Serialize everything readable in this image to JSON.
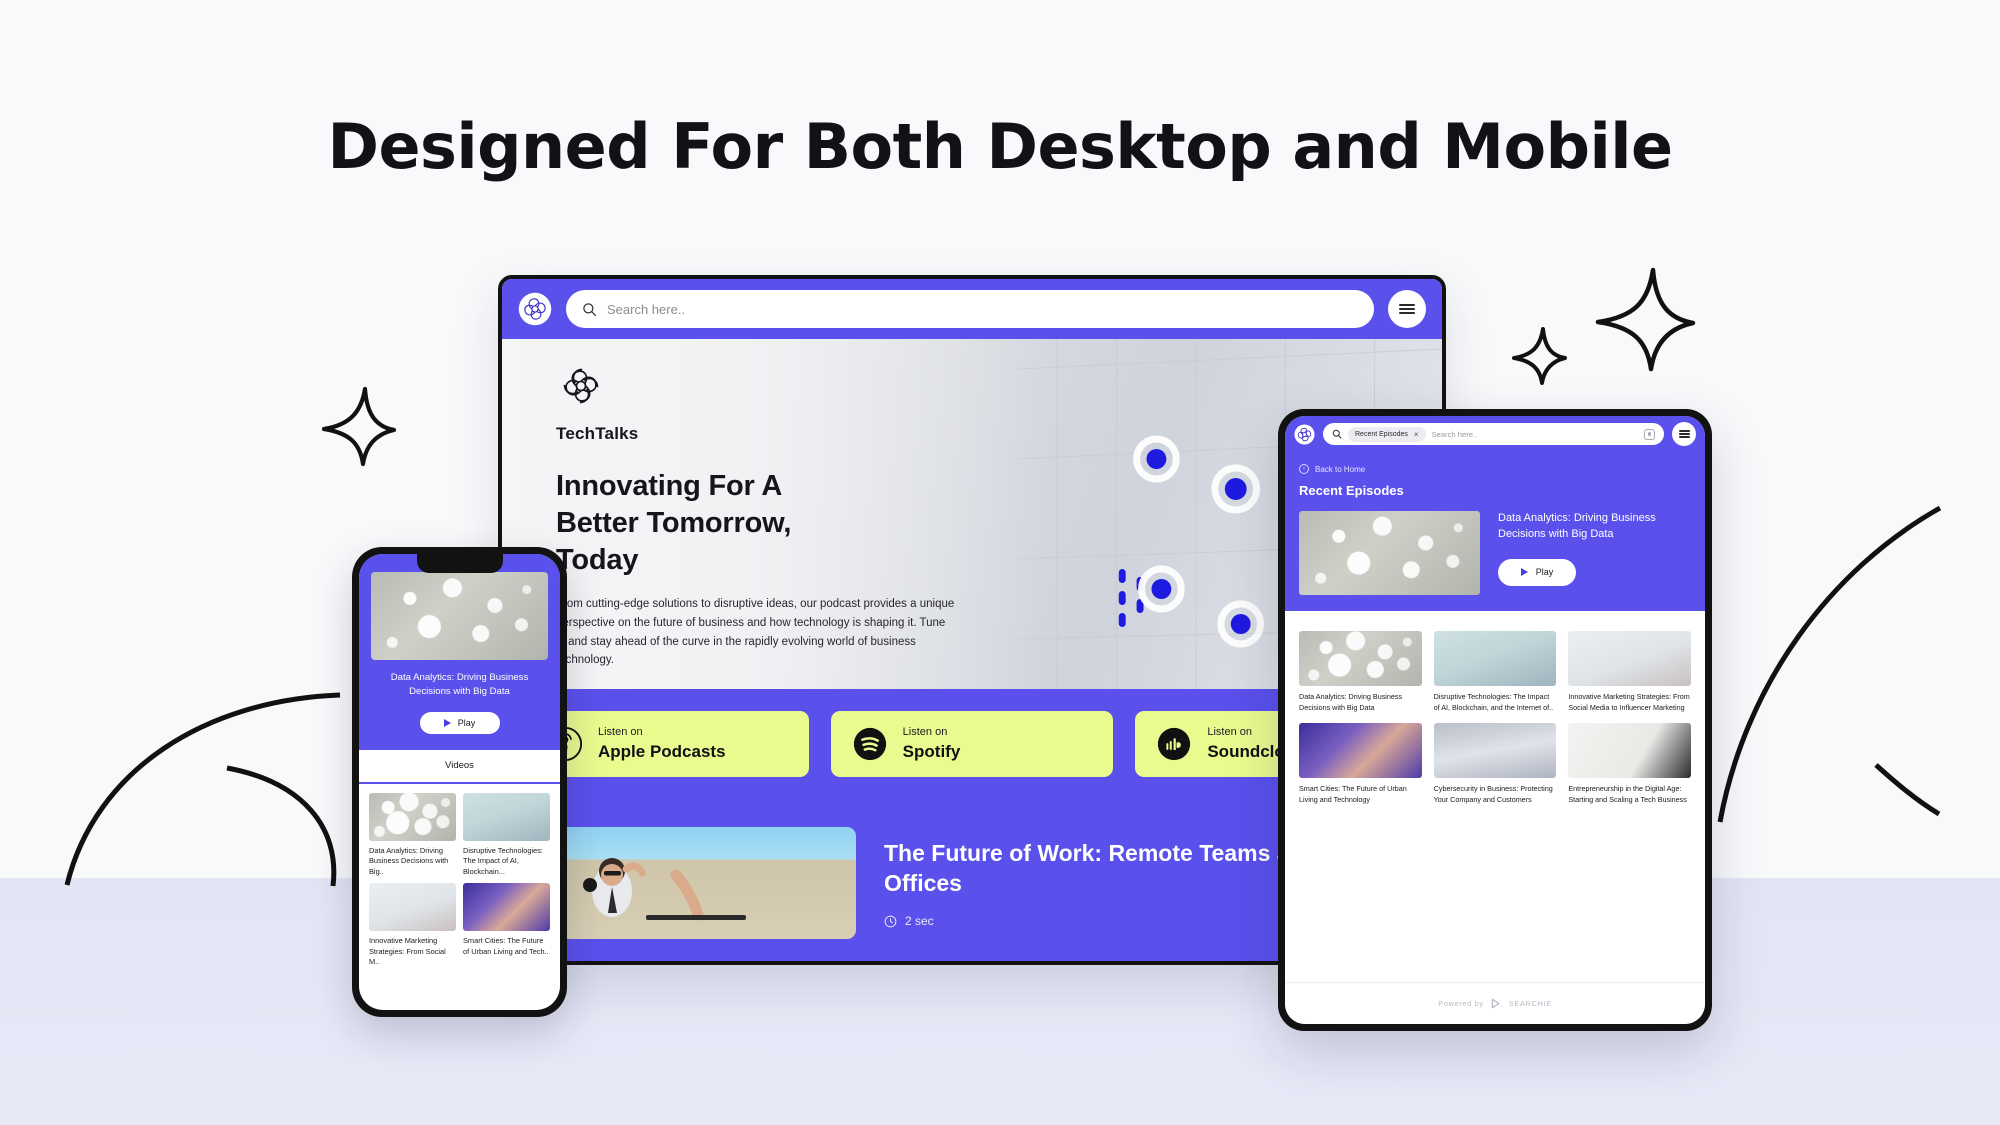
{
  "page": {
    "headline": "Designed For Both Desktop and Mobile",
    "colors": {
      "purple": "#5a50ec",
      "lime": "#e9fa8f",
      "background": "#f8f9fb",
      "lower_band": "#e4e7f5",
      "ink": "#121212"
    }
  },
  "desktop": {
    "topbar": {
      "logo": "techtalks-logo",
      "search_placeholder": "Search here..",
      "menu": "hamburger-menu"
    },
    "hero": {
      "brand": "TechTalks",
      "title": "Innovating For A Better Tomorrow, Today",
      "description": "From cutting-edge solutions to disruptive ideas, our podcast provides a unique perspective on the future of business and how technology is shaping it. Tune in and stay ahead of the curve in the rapidly evolving world of business technology."
    },
    "platforms": [
      {
        "eyebrow": "Listen on",
        "name": "Apple Podcasts",
        "icon": "apple-podcasts-icon"
      },
      {
        "eyebrow": "Listen on",
        "name": "Spotify",
        "icon": "spotify-icon"
      },
      {
        "eyebrow": "Listen on",
        "name": "Soundcloud",
        "icon": "soundcloud-icon"
      }
    ],
    "featured": {
      "title": "The Future of Work: Remote Teams and Virtual Offices",
      "duration": "2 sec",
      "duration_icon": "clock-icon",
      "thumb": "desert-podcast-photo"
    }
  },
  "phone": {
    "hero": {
      "thumb": "data-network-photo",
      "title": "Data Analytics: Driving Business Decisions with Big Data",
      "play_label": "Play"
    },
    "tab": "Videos",
    "videos": [
      {
        "title": "Data Analytics: Driving Business Decisions with Big..",
        "thumb": "data-network-photo"
      },
      {
        "title": "Disruptive Technologies: The Impact of AI, Blockchain...",
        "thumb": "robot-hand-photo"
      },
      {
        "title": "Innovative Marketing Strategies: From Social M..",
        "thumb": "woman-phone-photo"
      },
      {
        "title": "Smart Cities: The Future of Urban Living and Tech..",
        "thumb": "city-interchange-photo"
      }
    ]
  },
  "tablet": {
    "topbar": {
      "logo": "techtalks-logo",
      "chip_label": "Recent Episodes",
      "chip_remove": "×",
      "search_placeholder": "Search here..",
      "camera_icon": "camera-icon",
      "menu": "hamburger-menu"
    },
    "back_link": "Back to Home",
    "section_title": "Recent Episodes",
    "featured": {
      "thumb": "data-network-photo",
      "title": "Data Analytics: Driving Business Decisions with Big Data",
      "play_label": "Play"
    },
    "episodes": [
      {
        "title": "Data Analytics: Driving Business Decisions with Big Data",
        "thumb": "data-network-photo"
      },
      {
        "title": "Disruptive Technologies: The Impact of AI, Blockchain, and the Internet of..",
        "thumb": "robot-hand-photo"
      },
      {
        "title": "Innovative Marketing Strategies: From Social Media to Influencer Marketing",
        "thumb": "woman-phone-photo"
      },
      {
        "title": "Smart Cities: The Future of Urban Living and Technology",
        "thumb": "city-interchange-photo"
      },
      {
        "title": "Cybersecurity in Business: Protecting Your Company and Customers",
        "thumb": "cyber-blocks-photo"
      },
      {
        "title": "Entrepreneurship in the Digital Age: Starting and Scaling a Tech Business",
        "thumb": "chart-photo"
      }
    ],
    "footer": {
      "prefix": "Powered by",
      "brand": "SEARCHIE"
    }
  }
}
